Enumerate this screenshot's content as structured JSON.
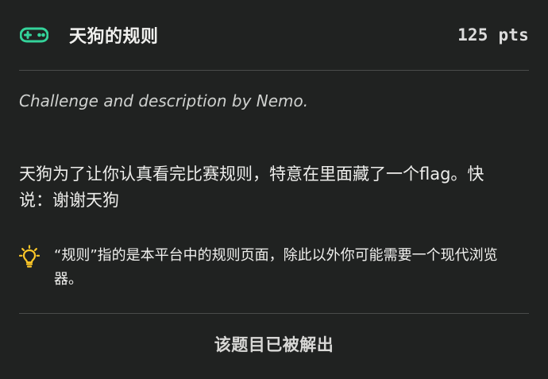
{
  "challenge": {
    "icon": "gamepad-icon",
    "title": "天狗的规则",
    "points": "125 pts",
    "author_line": "Challenge and description by Nemo.",
    "description": "天狗为了让你认真看完比赛规则，特意在里面藏了一个flag。快说：谢谢天狗",
    "hint": {
      "icon": "lightbulb-icon",
      "text": "“规则”指的是本平台中的规则页面，除此以外你可能需要一个现代浏览器。"
    },
    "status": "该题目已被解出"
  },
  "colors": {
    "background": "#202221",
    "accent_green": "#34d39a",
    "hint_yellow": "#ffc928",
    "divider": "#4a4c4b",
    "text": "#ededeb"
  }
}
